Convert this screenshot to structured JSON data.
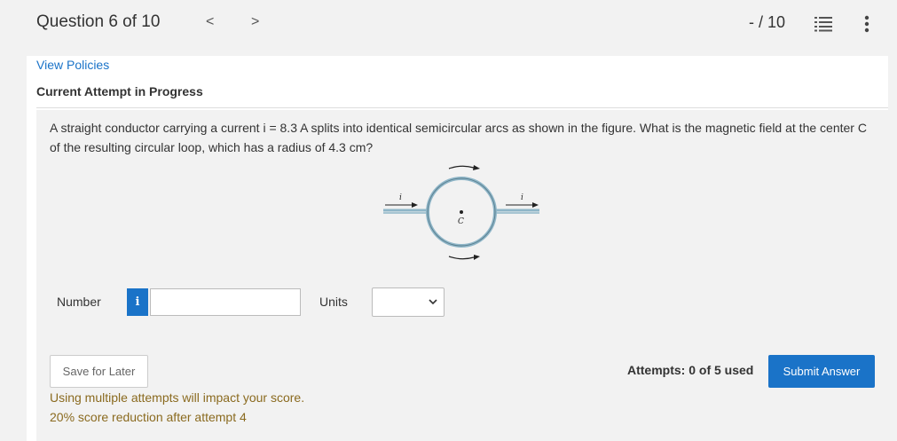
{
  "header": {
    "question_label": "Question 6 of 10",
    "prev_label": "<",
    "next_label": ">",
    "score": "- / 10",
    "list_icon": "list-icon",
    "more_icon": "more-vertical-icon"
  },
  "links": {
    "view_policies": "View Policies"
  },
  "attempt_heading": "Current Attempt in Progress",
  "question": {
    "text": "A straight conductor carrying a current i = 8.3 A splits into identical semicircular arcs as shown in the figure. What is the magnetic field at the center C of the resulting circular loop, which has a radius of 4.3 cm?",
    "figure": {
      "current_label_left": "i",
      "current_label_right": "i",
      "center_label": "C"
    }
  },
  "answer": {
    "number_label": "Number",
    "info_label": "i",
    "number_value": "",
    "units_label": "Units",
    "units_selected": ""
  },
  "actions": {
    "save_label": "Save for Later",
    "attempts_text": "Attempts: 0 of 5 used",
    "submit_label": "Submit Answer"
  },
  "notices": {
    "line1": "Using multiple attempts will impact your score.",
    "line2": "20% score reduction after attempt 4"
  },
  "colors": {
    "accent": "#1a73c8",
    "warning_text": "#8a6a1f",
    "loop": "#8fb6c8"
  }
}
